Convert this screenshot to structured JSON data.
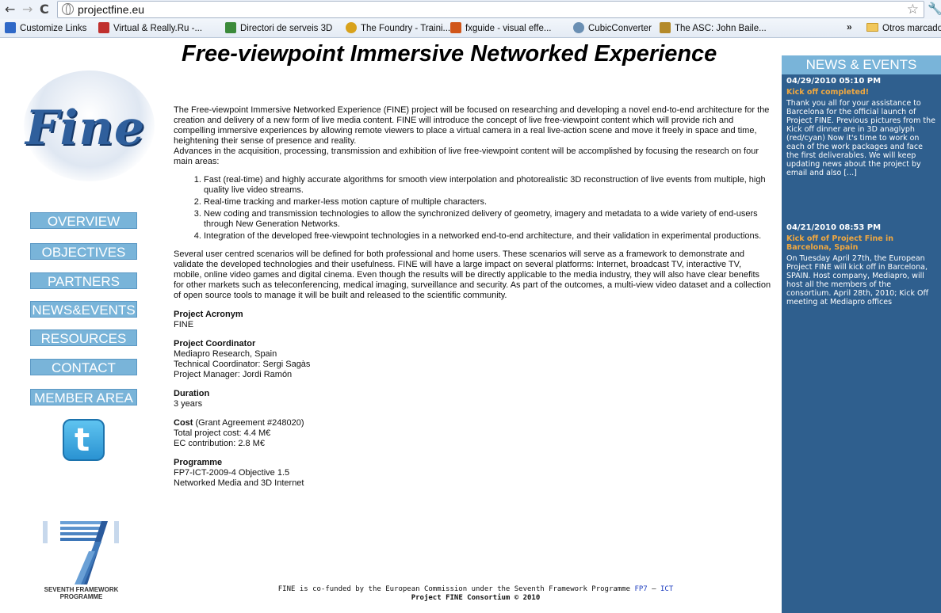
{
  "browser": {
    "url": "projectfine.eu",
    "bookmarks": [
      {
        "label": "Customize Links",
        "icon": "customize-links-icon",
        "color": "#2f68c7"
      },
      {
        "label": "Virtual & Really.Ru -...",
        "icon": "vr-icon",
        "color": "#c0302e"
      },
      {
        "label": "Directori de serveis 3D",
        "icon": "directori-icon",
        "color": "#3b8a3a"
      },
      {
        "label": "The Foundry - Traini...",
        "icon": "foundry-icon",
        "color": "#d8a21c"
      },
      {
        "label": "fxguide - visual effe...",
        "icon": "fxguide-icon",
        "color": "#d0561a"
      },
      {
        "label": "CubicConverter",
        "icon": "cubicconverter-icon",
        "color": "#6a8fb3"
      },
      {
        "label": "The ASC: John Baile...",
        "icon": "asc-icon",
        "color": "#b48a2a"
      }
    ],
    "more_label": "»",
    "other_bookmarks": "Otros marcadores"
  },
  "page": {
    "title": "Free-viewpoint Immersive Networked Experience",
    "logo_text": "Fine",
    "menu": [
      "OVERVIEW",
      "OBJECTIVES",
      "PARTNERS",
      "NEWS&EVENTS",
      "RESOURCES",
      "CONTACT",
      "MEMBER AREA"
    ],
    "fp7_label": "SEVENTH FRAMEWORK PROGRAMME",
    "intro": "The Free-viewpoint Immersive Networked Experience (FINE) project will be focused on researching and developing a novel end-to-end architecture for the creation and delivery of a new form of live media content. FINE will introduce the concept of live free-viewpoint content which will provide rich and compelling immersive experiences by allowing remote viewers to place a virtual camera in a real live-action scene and move it freely in space and time, heightening their sense of presence and reality.",
    "intro2": "Advances in the acquisition, processing, transmission and exhibition of live free-viewpoint content will be accomplished by focusing the research on four main areas:",
    "areas": [
      "Fast (real-time) and highly accurate algorithms for smooth view interpolation and photorealistic 3D reconstruction of live events from multiple, high quality live video streams.",
      "Real-time tracking and marker-less motion capture of multiple characters.",
      "New coding and transmission technologies to allow the synchronized delivery of geometry, imagery and metadata to a wide variety of end-users through New Generation Networks.",
      "Integration of the developed free-viewpoint technologies in a networked end-to-end architecture, and their validation in experimental productions."
    ],
    "scenarios": "Several user centred scenarios will be defined for both professional and home users.  These scenarios will serve as a framework to demonstrate and validate the developed technologies and their usefulness. FINE will have a large impact on several platforms: Internet, broadcast TV, interactive TV, mobile, online video games and digital cinema. Even though the results will be directly applicable to the media industry, they will also have clear benefits for other markets such as teleconferencing, medical imaging, surveillance and security. As part of the outcomes, a multi-view video dataset and a collection of open source tools to manage it will be built and released to the scientific community.",
    "acronym": {
      "head": "Project Acronym",
      "value": "FINE"
    },
    "coordinator": {
      "head": "Project Coordinator",
      "lines": [
        "Mediapro Research, Spain",
        "Technical Coordinator: Sergi Sagàs",
        "Project Manager: Jordi Ramón"
      ]
    },
    "duration": {
      "head": "Duration",
      "value": "3 years"
    },
    "cost": {
      "head": "Cost",
      "head_suffix": " (Grant Agreement #248020)",
      "lines": [
        "Total project cost: 4.4 M€",
        "EC contribution: 2.8 M€"
      ]
    },
    "programme": {
      "head": "Programme",
      "lines": [
        "FP7-ICT-2009-4 Objective 1.5",
        "Networked Media and 3D Internet"
      ]
    },
    "footer": {
      "text": "FINE is co-funded by the European Commission under the Seventh Framework Programme ",
      "link1": "FP7",
      "sep": " — ",
      "link2": "ICT",
      "consortium": "Project FINE Consortium © 2010"
    }
  },
  "news": {
    "header": "NEWS & EVENTS",
    "items": [
      {
        "date": "04/29/2010 05:10 PM",
        "title": "Kick off completed!",
        "body": "Thank you all for your assistance to Barcelona for the official launch of Project FINE. Previous pictures from the Kick off dinner are in 3D anaglyph (red/cyan) Now it's time to work on each of the work packages and face the first deliverables. We will keep updating news about the project by email and also [...]"
      },
      {
        "date": "04/21/2010 08:53 PM",
        "title": "Kick off of Project Fine in Barcelona, Spain",
        "body": "On Tuesday April 27th, the European Project FINE will kick off in Barcelona, SPAIN. Host company, Mediapro, will host all the members of the consortium. April 28th, 2010;  Kick Off meeting at Mediapro offices"
      }
    ]
  }
}
